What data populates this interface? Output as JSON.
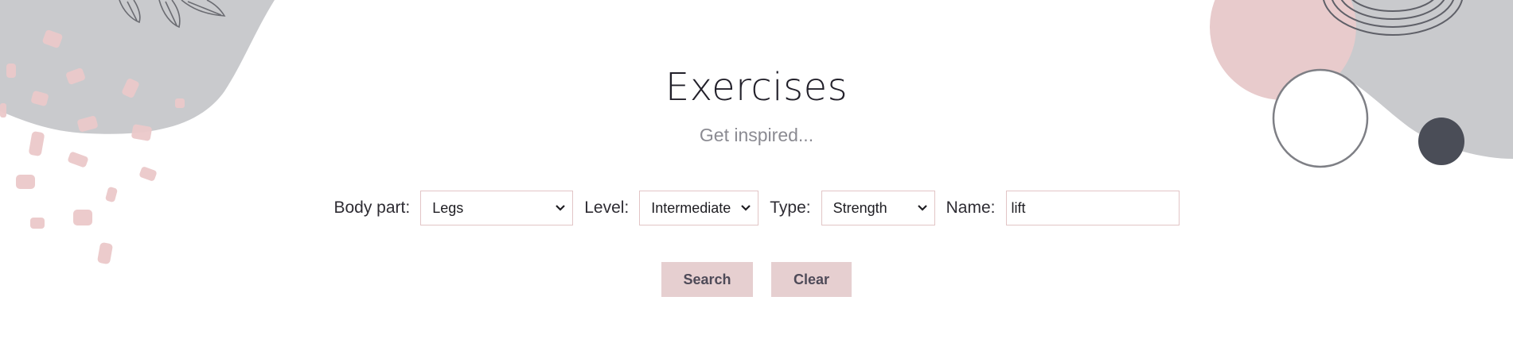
{
  "header": {
    "title": "Exercises",
    "subtitle": "Get inspired..."
  },
  "filters": {
    "body_part": {
      "label": "Body part:",
      "value": "Legs"
    },
    "level": {
      "label": "Level:",
      "value": "Intermediate"
    },
    "type": {
      "label": "Type:",
      "value": "Strength"
    },
    "name": {
      "label": "Name:",
      "value": "lift"
    }
  },
  "actions": {
    "search_label": "Search",
    "clear_label": "Clear"
  },
  "colors": {
    "accent_pink": "#e6cfd0",
    "field_border": "#e2c5c6",
    "decor_gray": "#c9cacd",
    "dark_dot": "#4a4d57"
  },
  "icons": {
    "dropdown": "chevron-down-icon"
  }
}
